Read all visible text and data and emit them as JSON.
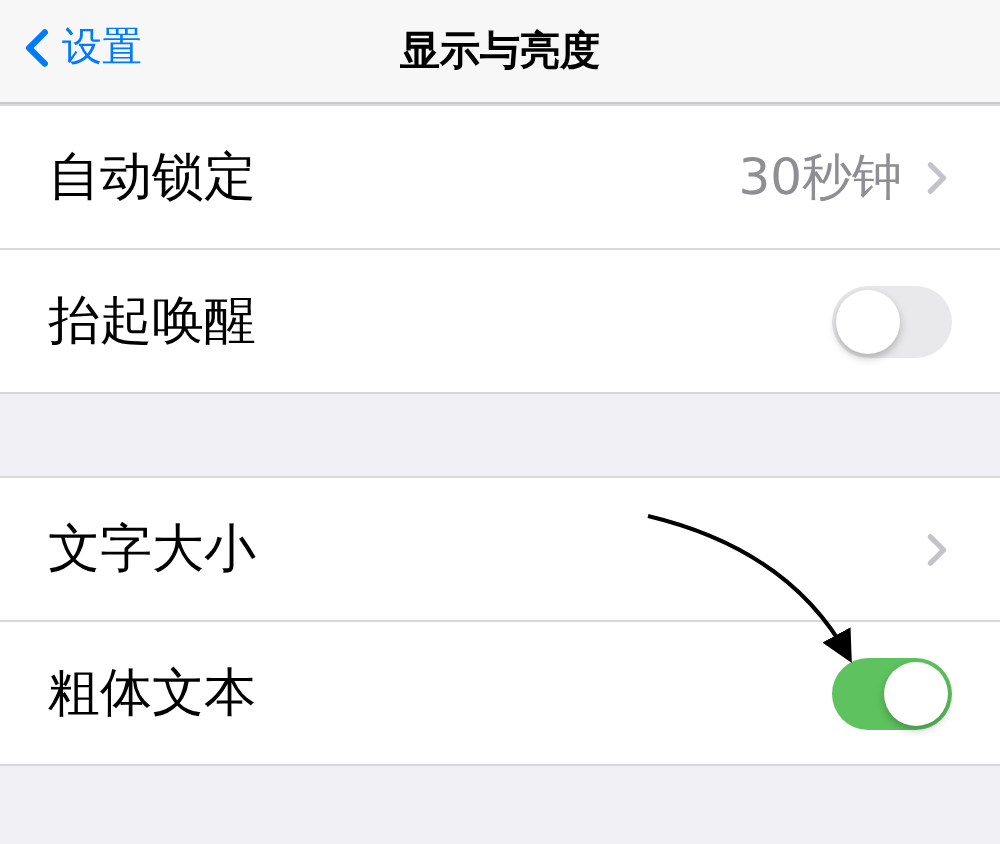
{
  "nav": {
    "back": "设置",
    "title": "显示与亮度"
  },
  "groups": [
    {
      "rows": [
        {
          "kind": "value",
          "label": "自动锁定",
          "value": "30秒钟"
        },
        {
          "kind": "toggle",
          "label": "抬起唤醒",
          "on": false
        }
      ]
    },
    {
      "rows": [
        {
          "kind": "link",
          "label": "文字大小"
        },
        {
          "kind": "toggle",
          "label": "粗体文本",
          "on": true
        }
      ]
    }
  ]
}
